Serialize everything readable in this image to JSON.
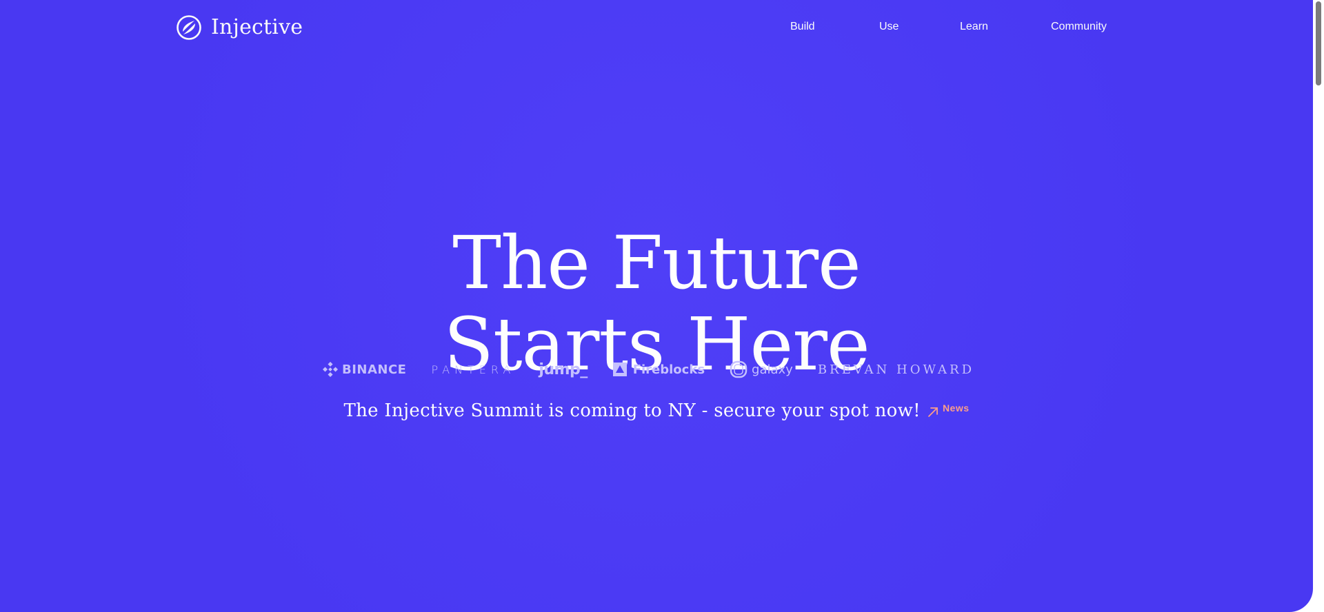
{
  "brand": {
    "name": "Injective",
    "logo_icon": "injective-swirl-icon"
  },
  "nav": {
    "items": [
      {
        "label": "Build"
      },
      {
        "label": "Use"
      },
      {
        "label": "Learn"
      },
      {
        "label": "Community"
      }
    ]
  },
  "hero": {
    "headline_line1": "The Future",
    "headline_line2": "Starts Here",
    "background_color": "#4a39f7"
  },
  "partners": [
    {
      "name": "BINANCE",
      "icon": "binance-diamond-icon"
    },
    {
      "name": "PANTERA"
    },
    {
      "name": "jump_"
    },
    {
      "name": "Fireblocks",
      "icon": "fireblocks-triangle-icon"
    },
    {
      "name": "galaxy",
      "icon": "galaxy-ring-icon"
    },
    {
      "name": "BREVAN HOWARD"
    }
  ],
  "announcement": {
    "text": "The Injective Summit is coming to NY - secure your spot now!",
    "tag": "News",
    "tag_icon": "arrow-up-right-icon",
    "tag_color": "#ff9f8a"
  }
}
